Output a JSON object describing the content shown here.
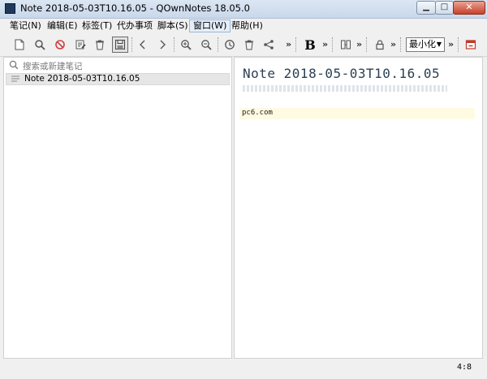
{
  "window": {
    "title": "Note 2018-05-03T10.16.05 - QOwnNotes 18.05.0",
    "buttons": {
      "minimize": "▁",
      "maximize": "□",
      "close": "✕"
    }
  },
  "menu": {
    "items": [
      {
        "label": "笔记(N)"
      },
      {
        "label": "编辑(E)"
      },
      {
        "label": "标签(T)"
      },
      {
        "label": "代办事项"
      },
      {
        "label": "脚本(S)"
      },
      {
        "label": "窗口(W)",
        "active": true
      },
      {
        "label": "帮助(H)"
      }
    ]
  },
  "toolbar": {
    "icons": [
      "new-note-icon",
      "find-icon",
      "delete-forbidden-icon",
      "edit-icon",
      "trash-icon",
      "save-icon",
      "back-icon",
      "forward-icon",
      "zoom-in-icon",
      "zoom-out-icon",
      "history-icon",
      "trash-alt-icon",
      "share-icon",
      "bold-icon",
      "split-view-icon",
      "lock-icon",
      "minimize-pane-icon"
    ],
    "bold_label": "B",
    "more": "»",
    "view_mode": "最小化"
  },
  "sidebar": {
    "search_placeholder": "搜索或新建笔记",
    "notes": [
      {
        "title": "Note 2018-05-03T10.16.05",
        "selected": true
      }
    ]
  },
  "editor": {
    "heading": "Note 2018-05-03T10.16.05",
    "lines": [
      "pc6.com"
    ]
  },
  "status": {
    "cursor_position": "4:8"
  },
  "colors": {
    "titlebar": "#c9d8ea",
    "heading": "#2b3f55",
    "code_highlight": "#fffbe3",
    "close_button": "#c7412a"
  }
}
